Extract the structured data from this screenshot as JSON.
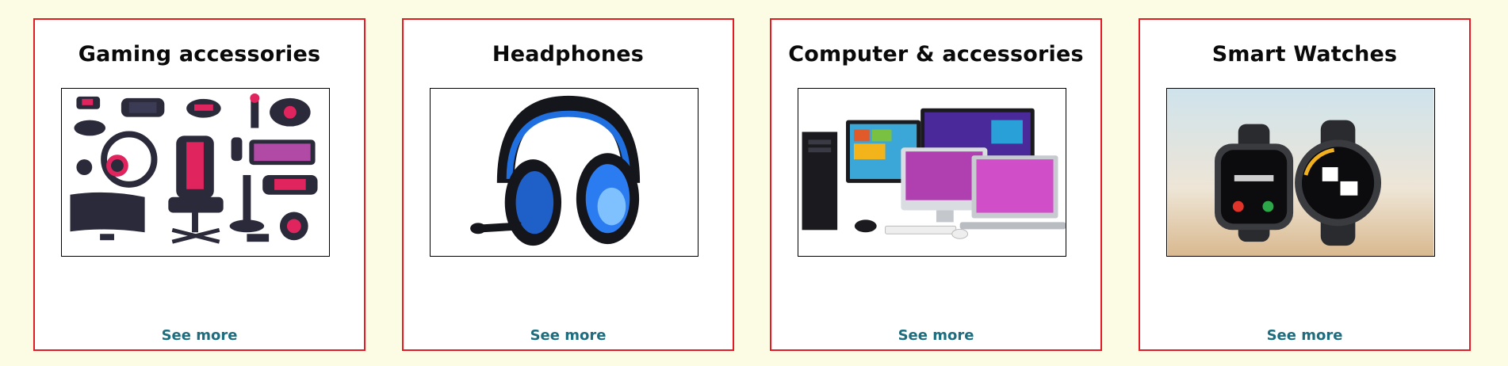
{
  "colors": {
    "page_background": "#fcfbe3",
    "card_border": "#e31b23",
    "see_more": "#1d6d7f"
  },
  "cards": [
    {
      "title": "Gaming accessories",
      "link_label": "See more",
      "image": "gaming-accessories-image"
    },
    {
      "title": "Headphones",
      "link_label": "See more",
      "image": "headphones-image"
    },
    {
      "title": "Computer & accessories",
      "link_label": "See more",
      "image": "computers-image"
    },
    {
      "title": "Smart Watches",
      "link_label": "See more",
      "image": "smart-watches-image"
    }
  ]
}
